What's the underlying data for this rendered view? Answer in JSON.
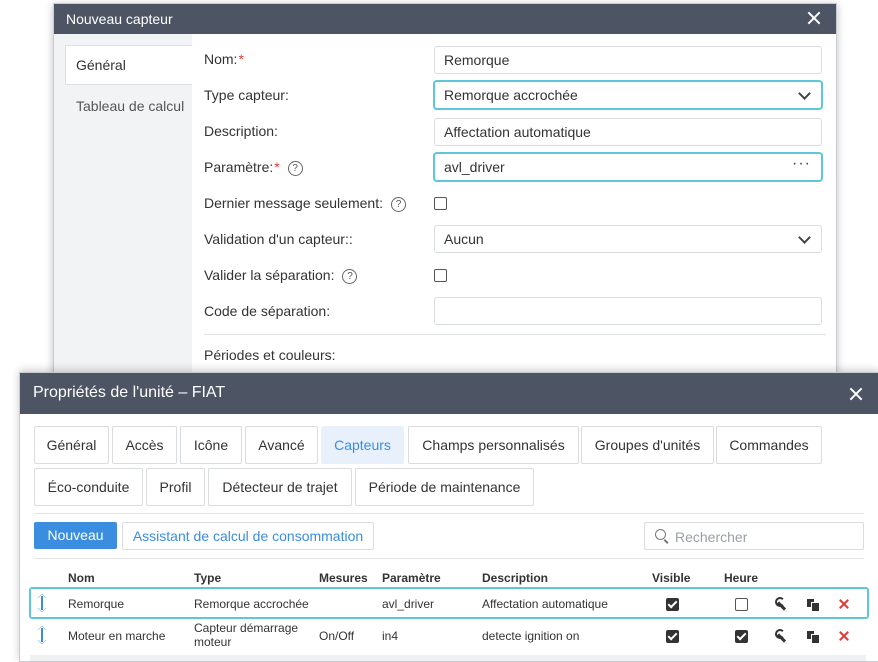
{
  "sensor_dialog": {
    "title": "Nouveau capteur",
    "tabs": [
      {
        "label": "Général",
        "active": true
      },
      {
        "label": "Tableau de calcul",
        "active": false
      }
    ],
    "fields": {
      "name_label": "Nom:",
      "name_value": "Remorque",
      "type_label": "Type capteur:",
      "type_value": "Remorque accrochée",
      "description_label": "Description:",
      "description_value": "Affectation automatique",
      "param_label": "Paramètre:",
      "param_value": "avl_driver",
      "last_msg_label": "Dernier message seulement:",
      "validation_label": "Validation d'un capteur::",
      "validation_value": "Aucun",
      "separation_label": "Valider la séparation:",
      "separation_code_label": "Code de séparation:",
      "separation_code_value": "",
      "periods_label": "Périodes et couleurs:",
      "required_mark": "*",
      "help_glyph": "?",
      "dots": "···"
    }
  },
  "unit_dialog": {
    "title": "Propriétés de l'unité – FIAT",
    "tabs": [
      {
        "label": "Général"
      },
      {
        "label": "Accès"
      },
      {
        "label": "Icône"
      },
      {
        "label": "Avancé"
      },
      {
        "label": "Capteurs",
        "active": true
      },
      {
        "label": "Champs personnalisés"
      },
      {
        "label": "Groupes d'unités"
      },
      {
        "label": "Commandes"
      },
      {
        "label": "Éco-conduite"
      },
      {
        "label": "Profil"
      },
      {
        "label": "Détecteur de trajet"
      },
      {
        "label": "Période de maintenance"
      }
    ],
    "new_button": "Nouveau",
    "wizard_button": "Assistant de calcul de consommation",
    "search_placeholder": "Rechercher",
    "columns": [
      "Nom",
      "Type",
      "Mesures",
      "Paramètre",
      "Description",
      "Visible",
      "Heure"
    ],
    "rows": [
      {
        "name": "Remorque",
        "type": "Remorque accrochée",
        "measures": "",
        "param": "avl_driver",
        "description": "Affectation automatique",
        "visible": true,
        "time": false,
        "selected": true
      },
      {
        "name": "Moteur en marche",
        "type_line1": "Capteur démarrage",
        "type_line2": "moteur",
        "measures": "On/Off",
        "param": "in4",
        "description": "detecte ignition on",
        "visible": true,
        "time": true,
        "selected": false
      }
    ],
    "colors": {
      "accent": "#3b8de0",
      "header": "#4d5564",
      "focus": "#5fc5d8",
      "delete": "#e53935"
    }
  }
}
